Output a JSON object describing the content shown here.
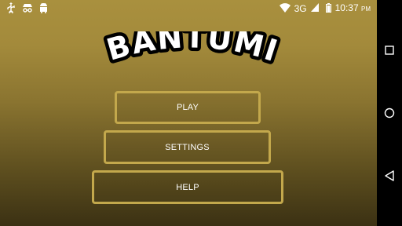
{
  "status_bar": {
    "icons_left": [
      "usb-icon",
      "incognito-icon",
      "android-icon"
    ],
    "network": "3G",
    "time": "10:37",
    "ampm": "PM"
  },
  "game": {
    "title": "BANTUMI"
  },
  "menu": {
    "play_label": "PLAY",
    "settings_label": "SETTINGS",
    "help_label": "HELP"
  },
  "nav_bar": {
    "icons": [
      "recent-apps-icon",
      "home-icon",
      "back-icon"
    ]
  },
  "colors": {
    "background_top": "#a9903e",
    "background_bottom": "#3b3113",
    "button_border": "#c3a84c",
    "text": "#ffffff"
  }
}
